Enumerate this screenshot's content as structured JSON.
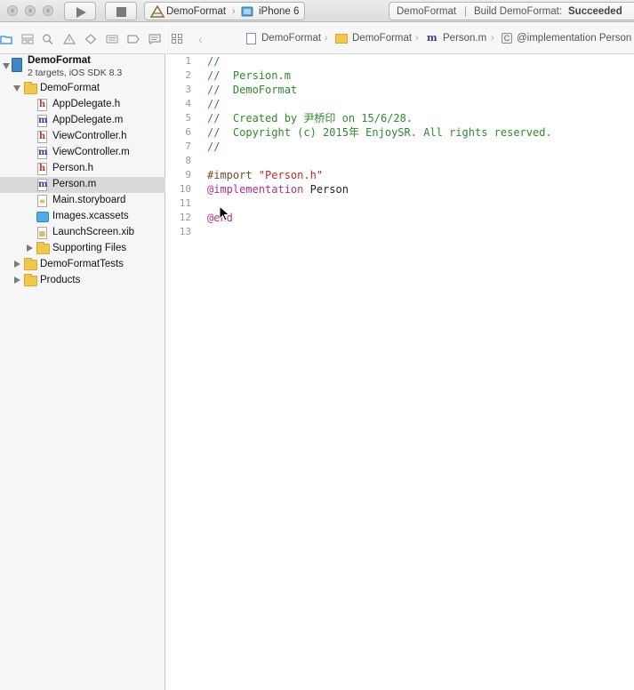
{
  "toolbar": {
    "scheme_project": "DemoFormat",
    "scheme_device": "iPhone 6",
    "activity_project": "DemoFormat",
    "activity_separator": "|",
    "activity_status_prefix": "Build DemoFormat:",
    "activity_status_value": "Succeeded"
  },
  "navigator": {
    "project": {
      "name": "DemoFormat",
      "subtitle": "2 targets, iOS SDK 8.3"
    },
    "items": [
      {
        "label": "DemoFormat",
        "kind": "folder",
        "expanded": true
      },
      {
        "label": "AppDelegate.h",
        "kind": "h"
      },
      {
        "label": "AppDelegate.m",
        "kind": "m"
      },
      {
        "label": "ViewController.h",
        "kind": "h"
      },
      {
        "label": "ViewController.m",
        "kind": "m"
      },
      {
        "label": "Person.h",
        "kind": "h"
      },
      {
        "label": "Person.m",
        "kind": "m",
        "selected": true
      },
      {
        "label": "Main.storyboard",
        "kind": "storyboard"
      },
      {
        "label": "Images.xcassets",
        "kind": "xcassets"
      },
      {
        "label": "LaunchScreen.xib",
        "kind": "xib"
      },
      {
        "label": "Supporting Files",
        "kind": "folder",
        "expanded": false
      },
      {
        "label": "DemoFormatTests",
        "kind": "folder",
        "expanded": false
      },
      {
        "label": "Products",
        "kind": "folder",
        "expanded": false
      }
    ]
  },
  "jumpbar": {
    "crumbs": [
      "DemoFormat",
      "DemoFormat",
      "Person.m",
      "@implementation Person"
    ]
  },
  "editor": {
    "lines": [
      {
        "n": "1",
        "text": "//"
      },
      {
        "n": "2",
        "text": "//  Persion.m"
      },
      {
        "n": "3",
        "text": "//  DemoFormat"
      },
      {
        "n": "4",
        "text": "//"
      },
      {
        "n": "5",
        "text": "//  Created by 尹桥印 on 15/6/28."
      },
      {
        "n": "6",
        "text": "//  Copyright (c) 2015年 EnjoySR. All rights reserved."
      },
      {
        "n": "7",
        "text": "//"
      },
      {
        "n": "8",
        "text": ""
      },
      {
        "n": "9",
        "pre": "#import ",
        "string": "\"Person.h\""
      },
      {
        "n": "10",
        "kw": "@implementation",
        "plain": " Person"
      },
      {
        "n": "11",
        "text": ""
      },
      {
        "n": "12",
        "kw": "@end"
      },
      {
        "n": "13",
        "text": ""
      }
    ]
  },
  "colors": {
    "comment": "#2e8a2e",
    "preprocessor": "#7a4b2d",
    "string": "#c4281c",
    "keyword": "#b6308f",
    "selection": "#d9d9d9"
  },
  "icons": [
    "run-icon",
    "stop-icon",
    "project-navigator-icon",
    "folder-icon",
    "header-file-icon",
    "implementation-file-icon",
    "storyboard-icon",
    "asset-catalog-icon",
    "xib-icon",
    "grid-icon",
    "back-arrow-icon",
    "mouse-pointer-icon"
  ]
}
